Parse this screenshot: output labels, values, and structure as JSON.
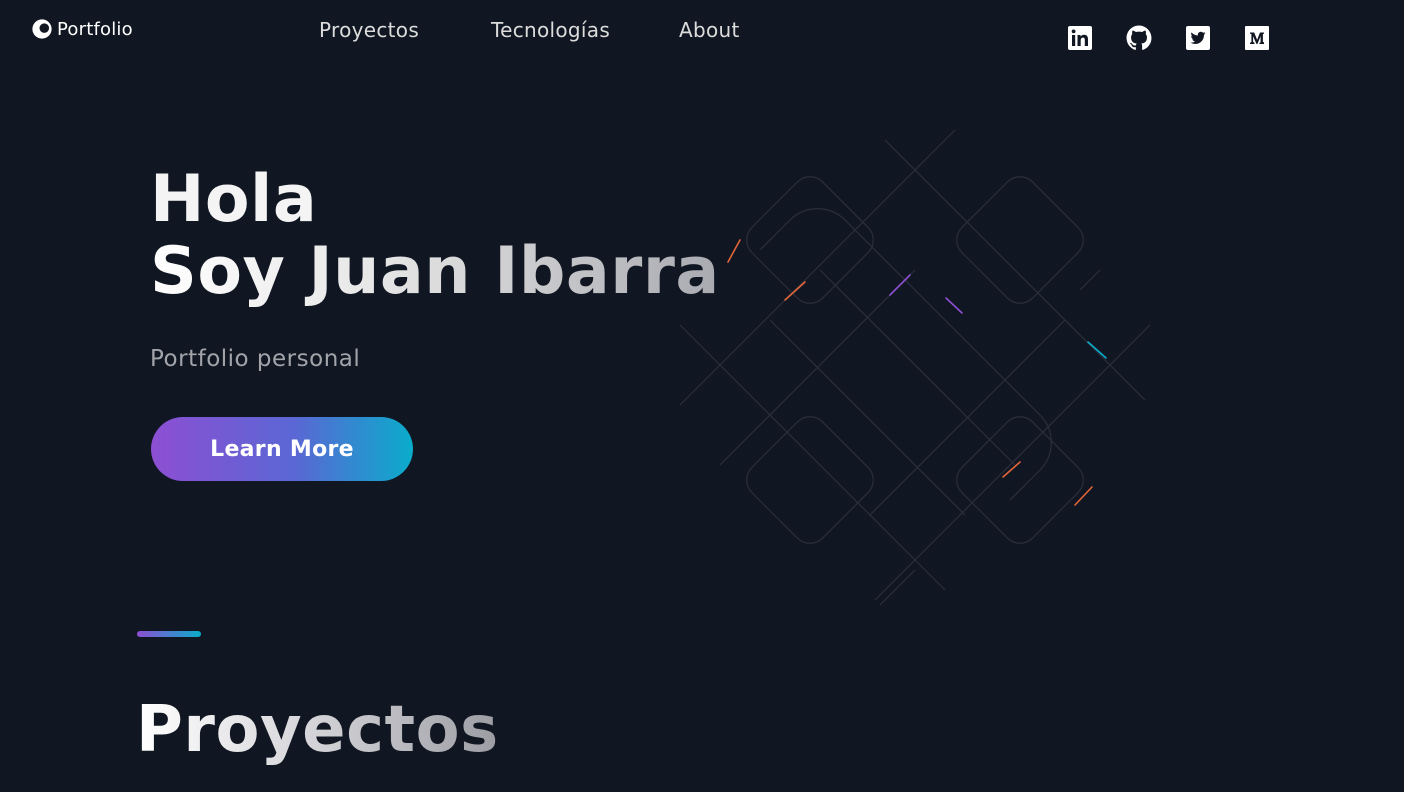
{
  "header": {
    "logo_text": "Portfolio",
    "nav": [
      {
        "label": "Proyectos",
        "name": "nav-proyectos"
      },
      {
        "label": "Tecnologías",
        "name": "nav-tecnologias"
      },
      {
        "label": "About",
        "name": "nav-about"
      }
    ],
    "social": [
      {
        "name": "linkedin-icon"
      },
      {
        "name": "github-icon"
      },
      {
        "name": "twitter-icon"
      },
      {
        "name": "medium-icon"
      }
    ]
  },
  "hero": {
    "greeting": "Hola",
    "name_line": "Soy Juan Ibarra",
    "subtitle": "Portfolio personal",
    "cta_label": "Learn More"
  },
  "projects": {
    "title": "Proyectos"
  },
  "colors": {
    "background": "#111722",
    "gradient_start": "#8d4fd3",
    "gradient_end": "#0aaccb",
    "muted_text": "#a2a4aa"
  }
}
